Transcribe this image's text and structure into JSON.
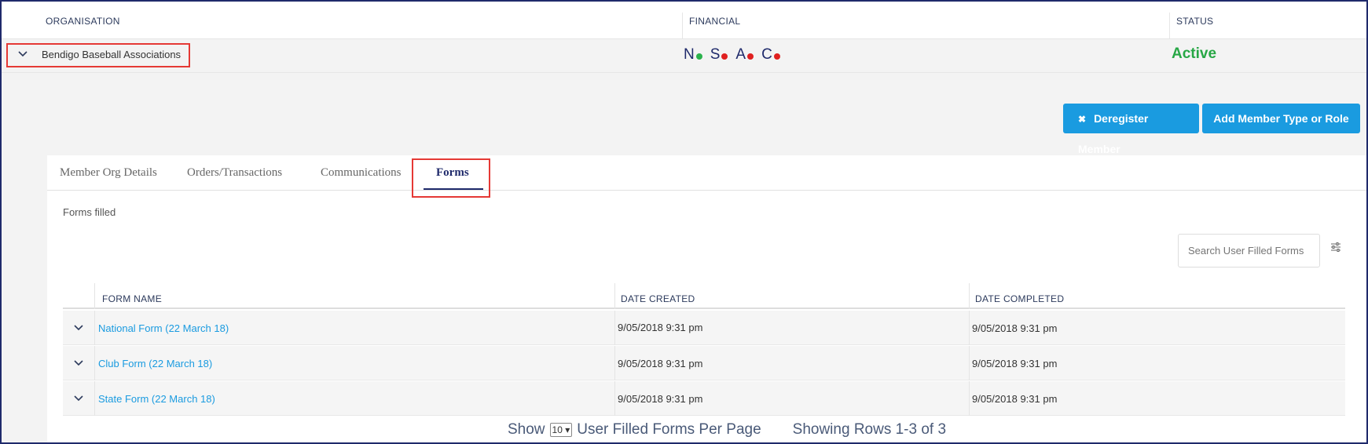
{
  "header": {
    "columns": [
      "ORGANISATION",
      "FINANCIAL",
      "STATUS"
    ]
  },
  "org": {
    "name": "Bendigo Baseball Associations",
    "financial": [
      {
        "letter": "N",
        "color": "#2bb24c"
      },
      {
        "letter": "S",
        "color": "#e02020"
      },
      {
        "letter": "A",
        "color": "#e02020"
      },
      {
        "letter": "C",
        "color": "#e02020"
      }
    ],
    "status": "Active"
  },
  "actions": {
    "deregister": "Deregister Member",
    "add_type": "Add Member Type or Role"
  },
  "tabs": [
    {
      "label": "Member Org Details"
    },
    {
      "label": "Orders/Transactions"
    },
    {
      "label": "Communications"
    },
    {
      "label": "Forms"
    }
  ],
  "forms": {
    "section_title": "Forms filled",
    "search_placeholder": "Search User Filled Forms",
    "columns": [
      "FORM NAME",
      "DATE CREATED",
      "DATE COMPLETED"
    ],
    "rows": [
      {
        "name": "National Form (22 March 18)",
        "created": "9/05/2018 9:31 pm",
        "completed": "9/05/2018 9:31 pm"
      },
      {
        "name": "Club Form (22 March 18)",
        "created": "9/05/2018 9:31 pm",
        "completed": "9/05/2018 9:31 pm"
      },
      {
        "name": "State Form (22 March 18)",
        "created": "9/05/2018 9:31 pm",
        "completed": "9/05/2018 9:31 pm"
      }
    ]
  },
  "pagination": {
    "show": "Show",
    "per_page_value": "10",
    "per_page_label": "User Filled Forms Per Page",
    "showing": "Showing Rows 1-3 of 3"
  }
}
